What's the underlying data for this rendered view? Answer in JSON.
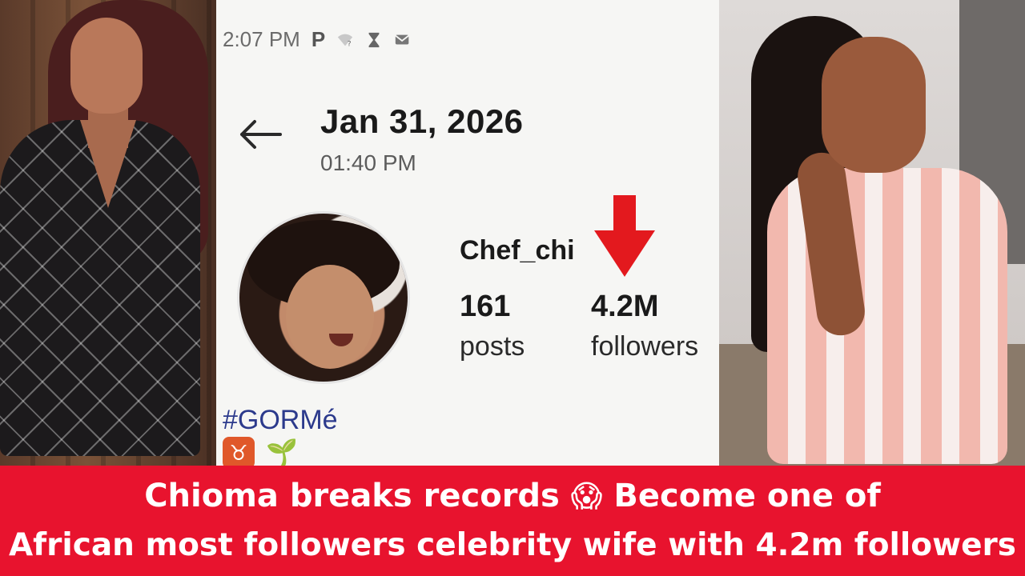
{
  "status_bar": {
    "time": "2:07 PM",
    "p_label": "P"
  },
  "header": {
    "date": "Jan 31, 2026",
    "time": "01:40 PM"
  },
  "profile": {
    "username": "Chef_chi",
    "posts_count": "161",
    "posts_label": "posts",
    "followers_count": "4.2M",
    "followers_label": "followers",
    "hashtag": "#GORMé",
    "zodiac_icon": "taurus-icon",
    "plant_icon": "seedling-icon"
  },
  "caption": {
    "line1_a": "Chioma breaks records",
    "line1_emoji": "😱",
    "line1_b": "Become one of",
    "line2": "African most followers celebrity wife with 4.2m followers"
  },
  "colors": {
    "banner": "#e8132e",
    "arrow": "#e3191e",
    "hashtag": "#2c3a8c"
  }
}
